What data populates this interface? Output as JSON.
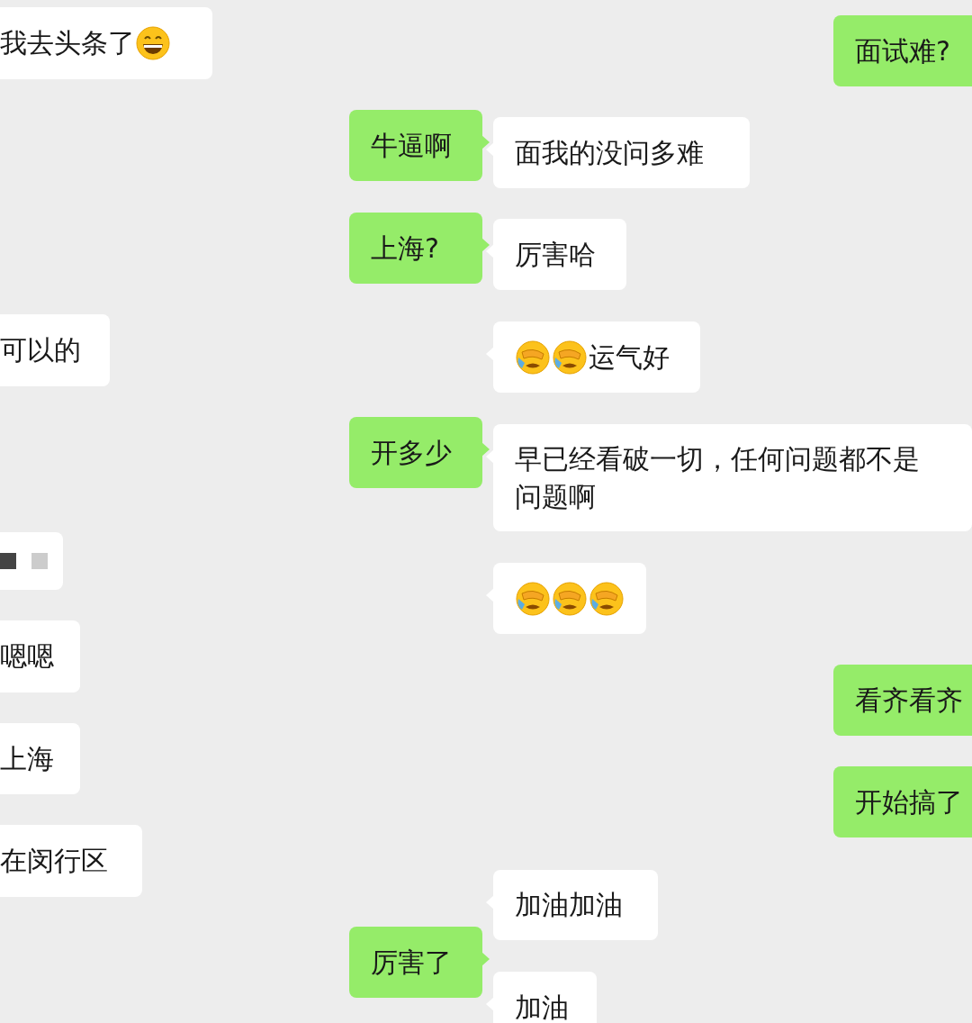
{
  "messages": [
    {
      "sent": false,
      "parts": [
        {
          "kind": "text",
          "text": "我去头条了"
        },
        {
          "kind": "grin"
        }
      ]
    },
    {
      "sent": true,
      "parts": [
        {
          "kind": "text",
          "text": "面试难?"
        }
      ]
    },
    {
      "sent": true,
      "parts": [
        {
          "kind": "text",
          "text": "牛逼啊"
        }
      ]
    },
    {
      "sent": false,
      "parts": [
        {
          "kind": "text",
          "text": "面我的没问多难"
        }
      ]
    },
    {
      "sent": true,
      "parts": [
        {
          "kind": "text",
          "text": "上海?"
        }
      ]
    },
    {
      "sent": false,
      "parts": [
        {
          "kind": "text",
          "text": "厉害哈"
        }
      ]
    },
    {
      "sent": false,
      "parts": [
        {
          "kind": "text",
          "text": "可以的"
        }
      ]
    },
    {
      "sent": false,
      "parts": [
        {
          "kind": "facepalm"
        },
        {
          "kind": "facepalm"
        },
        {
          "kind": "text",
          "text": "运气好"
        }
      ]
    },
    {
      "sent": true,
      "parts": [
        {
          "kind": "text",
          "text": "开多少"
        }
      ]
    },
    {
      "sent": false,
      "parts": [
        {
          "kind": "text",
          "text": "早已经看破一切，任何问题都不是问题啊"
        }
      ]
    },
    {
      "sent": false,
      "parts": [
        {
          "kind": "redacted"
        }
      ]
    },
    {
      "sent": false,
      "parts": [
        {
          "kind": "facepalm"
        },
        {
          "kind": "facepalm"
        },
        {
          "kind": "facepalm"
        }
      ]
    },
    {
      "sent": false,
      "parts": [
        {
          "kind": "text",
          "text": "嗯嗯"
        }
      ]
    },
    {
      "sent": true,
      "parts": [
        {
          "kind": "text",
          "text": "看齐看齐"
        }
      ]
    },
    {
      "sent": false,
      "parts": [
        {
          "kind": "text",
          "text": "上海"
        }
      ]
    },
    {
      "sent": true,
      "parts": [
        {
          "kind": "text",
          "text": "开始搞了"
        }
      ]
    },
    {
      "sent": false,
      "parts": [
        {
          "kind": "text",
          "text": "在闵行区"
        }
      ]
    },
    {
      "sent": false,
      "parts": [
        {
          "kind": "text",
          "text": "加油加油"
        }
      ]
    },
    {
      "sent": true,
      "parts": [
        {
          "kind": "text",
          "text": "厉害了"
        }
      ]
    },
    {
      "sent": false,
      "parts": [
        {
          "kind": "text",
          "text": "加油"
        }
      ]
    }
  ]
}
